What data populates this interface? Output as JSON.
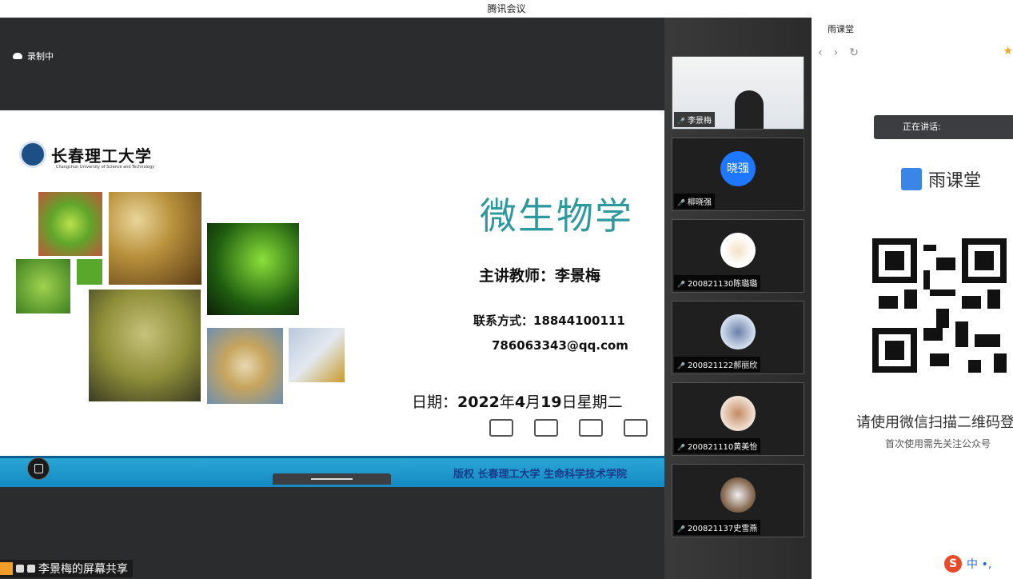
{
  "window": {
    "title": "腾讯会议"
  },
  "recording": {
    "label": "录制中"
  },
  "slide": {
    "university_cn": "长春理工大学",
    "university_en": "Changchun University of Science and Technology",
    "course_title": "微生物学",
    "teacher": "主讲教师：李景梅",
    "contact": "联系方式：18844100111",
    "email": "786063343@qq.com",
    "date_prefix": "日期：",
    "date_value": "2022",
    "date_year_unit": "年",
    "date_month": "4",
    "date_month_unit": "月",
    "date_day": "19",
    "date_day_unit": "日星期二",
    "copyright": "版权 长春理工大学 生命科学技术学院"
  },
  "share": {
    "label": "李景梅的屏幕共享"
  },
  "participants": [
    {
      "name": "李景梅",
      "avatar_text": ""
    },
    {
      "name": "柳晓强",
      "avatar_text": "晓强"
    },
    {
      "name": "200821130陈璐璐",
      "avatar_text": ""
    },
    {
      "name": "200821122郝丽欣",
      "avatar_text": ""
    },
    {
      "name": "200821110黄美怡",
      "avatar_text": ""
    },
    {
      "name": "200821137史雪燕",
      "avatar_text": ""
    }
  ],
  "yuketang": {
    "window_title": "雨课堂",
    "speaking_label": "正在讲话:",
    "brand": "雨课堂",
    "qr_prompt": "请使用微信扫描二维码登录",
    "qr_note": "首次使用需先关注公众号"
  },
  "ime": {
    "label": "中 •,"
  },
  "colors": {
    "accent_teal": "#2e9a9e",
    "bar_blue": "#1489c2",
    "avatar_blue": "#1e78ff"
  }
}
